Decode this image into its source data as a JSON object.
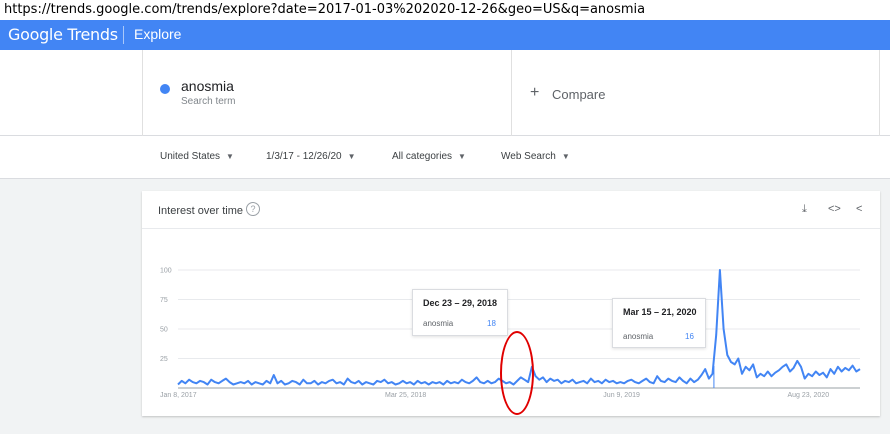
{
  "caption": {
    "url": "https://trends.google.com/trends/explore?date=2017-01-03%202020-12-26&geo=US&q=anosmia"
  },
  "header": {
    "brand": "Google Trends",
    "section": "Explore",
    "color": "#4285f4"
  },
  "search": {
    "term": "anosmia",
    "term_type": "Search term",
    "term_color": "#4285f4",
    "compare_icon": "+",
    "compare_label": "Compare"
  },
  "filters": {
    "region": "United States",
    "date_range": "1/3/17 - 12/26/20",
    "category": "All categories",
    "search_type": "Web Search"
  },
  "card": {
    "title": "Interest over time",
    "help_icon": "?",
    "download_icon": "⤓",
    "embed_icon": "<>",
    "share_icon": "<"
  },
  "tooltips": [
    {
      "date": "Dec 23 – 29, 2018",
      "term": "anosmia",
      "value": "18"
    },
    {
      "date": "Mar 15 – 21, 2020",
      "term": "anosmia",
      "value": "16"
    }
  ],
  "chart_data": {
    "type": "line",
    "series": [
      {
        "name": "anosmia",
        "color": "#4285f4",
        "values": [
          3,
          6,
          4,
          7,
          5,
          4,
          6,
          5,
          3,
          7,
          5,
          4,
          6,
          8,
          5,
          3,
          4,
          5,
          4,
          6,
          3,
          5,
          4,
          3,
          6,
          4,
          11,
          4,
          6,
          3,
          4,
          6,
          5,
          3,
          7,
          4,
          4,
          6,
          3,
          5,
          4,
          6,
          7,
          4,
          5,
          3,
          8,
          5,
          4,
          6,
          3,
          5,
          4,
          3,
          6,
          5,
          7,
          4,
          5,
          3,
          4,
          6,
          4,
          5,
          3,
          6,
          4,
          5,
          3,
          5,
          4,
          5,
          3,
          6,
          4,
          5,
          4,
          7,
          5,
          4,
          6,
          9,
          5,
          4,
          6,
          4,
          5,
          8,
          6,
          4,
          5,
          3,
          6,
          9,
          7,
          5,
          18,
          10,
          7,
          9,
          5,
          8,
          6,
          7,
          4,
          6,
          5,
          7,
          4,
          5,
          6,
          4,
          8,
          5,
          6,
          4,
          7,
          5,
          6,
          4,
          5,
          4,
          6,
          7,
          5,
          4,
          6,
          8,
          5,
          4,
          10,
          6,
          5,
          8,
          6,
          5,
          9,
          6,
          4,
          8,
          5,
          7,
          11,
          16,
          8,
          12,
          45,
          100,
          50,
          28,
          22,
          20,
          25,
          12,
          18,
          15,
          20,
          9,
          12,
          10,
          14,
          10,
          13,
          15,
          18,
          20,
          14,
          17,
          23,
          18,
          8,
          12,
          10,
          14,
          11,
          13,
          9,
          16,
          12,
          18,
          14,
          17,
          15,
          19,
          14,
          16
        ]
      }
    ],
    "x_tick_labels": [
      "Jan 8, 2017",
      "Mar 25, 2018",
      "Jun 9, 2019",
      "Aug 23, 2020"
    ],
    "y_ticks": [
      25,
      50,
      75,
      100
    ],
    "ylim": [
      0,
      100
    ],
    "grid": true
  }
}
